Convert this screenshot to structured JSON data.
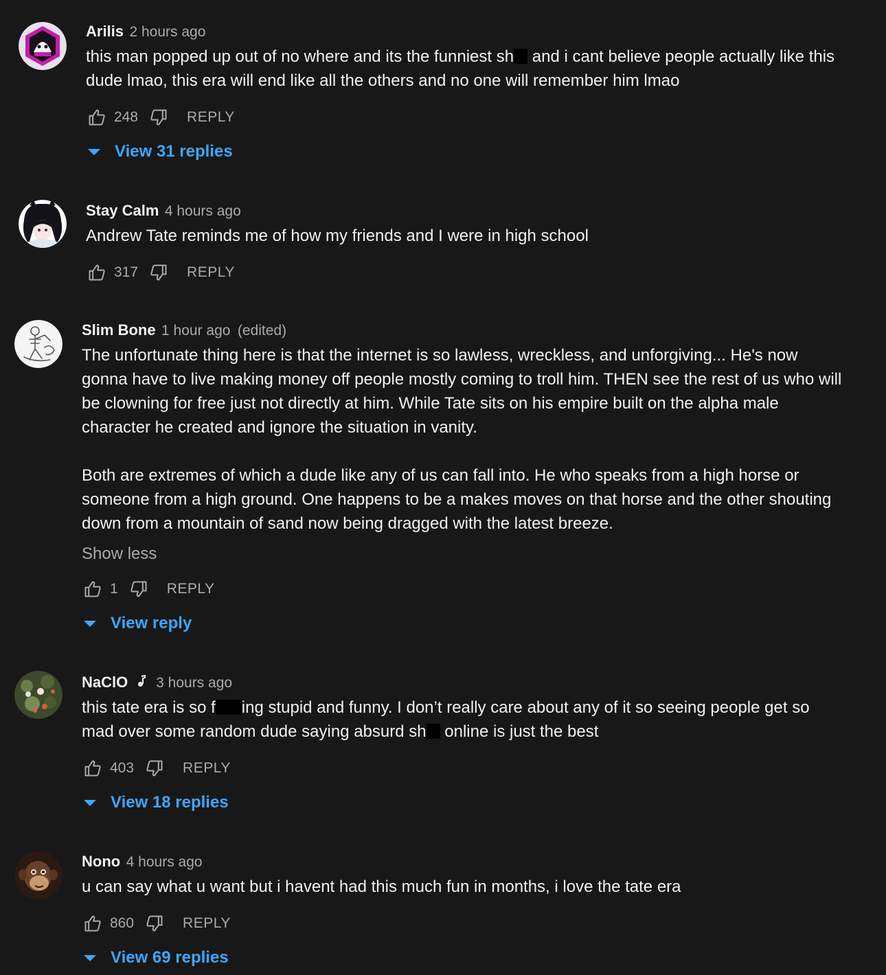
{
  "comments": [
    {
      "author": "Arilis",
      "time": "2 hours ago",
      "text_parts": [
        "this man popped up out of no where and its the funniest sh",
        " and i cant believe people actually like this dude lmao, this era will end like all the others and no one will remember him lmao"
      ],
      "likes": "248",
      "reply_label": "REPLY",
      "view_replies": "View 31 replies"
    },
    {
      "author": "Stay Calm",
      "time": "4 hours ago",
      "text": "Andrew Tate reminds me of how my friends and I were in high school",
      "likes": "317",
      "reply_label": "REPLY"
    },
    {
      "author": "Slim Bone",
      "time": "1 hour ago",
      "edited": "(edited)",
      "paragraphs": [
        "The unfortunate thing here is that the internet is so lawless, wreckless, and unforgiving... He's now gonna have to live making money off people mostly coming to troll him. THEN see the rest of us who will be clowning for free just not directly at him. While Tate sits on his empire built on the alpha male character he created and ignore the situation in vanity.",
        "Both are extremes of which a dude like any of us can fall into. He who speaks from a high horse or someone from a high ground. One happens to be a makes moves on that horse and the other shouting down from a mountain of sand now being dragged with the latest breeze."
      ],
      "show_less": "Show less",
      "likes": "1",
      "reply_label": "REPLY",
      "view_replies": "View reply"
    },
    {
      "author": "NaClO",
      "badge_icon": "music-note-icon",
      "time": "3 hours ago",
      "text_parts": [
        "this tate era is so f",
        "ing stupid and funny. I don’t really care about any of it so seeing people get so mad over some random dude saying absurd sh",
        " online is just the best"
      ],
      "likes": "403",
      "reply_label": "REPLY",
      "view_replies": "View 18 replies"
    },
    {
      "author": "Nono",
      "time": "4 hours ago",
      "text": "u can say what u want but i havent had this much fun in months, i love the tate era",
      "likes": "860",
      "reply_label": "REPLY",
      "view_replies": "View 69 replies"
    }
  ],
  "colors": {
    "background": "#181818",
    "text": "#f1f1f1",
    "secondary": "#aaaaaa",
    "link": "#3ea6ff",
    "censor": "#000000"
  },
  "icons": {
    "like": "thumbs-up-icon",
    "dislike": "thumbs-down-icon",
    "expand": "caret-down-icon"
  }
}
